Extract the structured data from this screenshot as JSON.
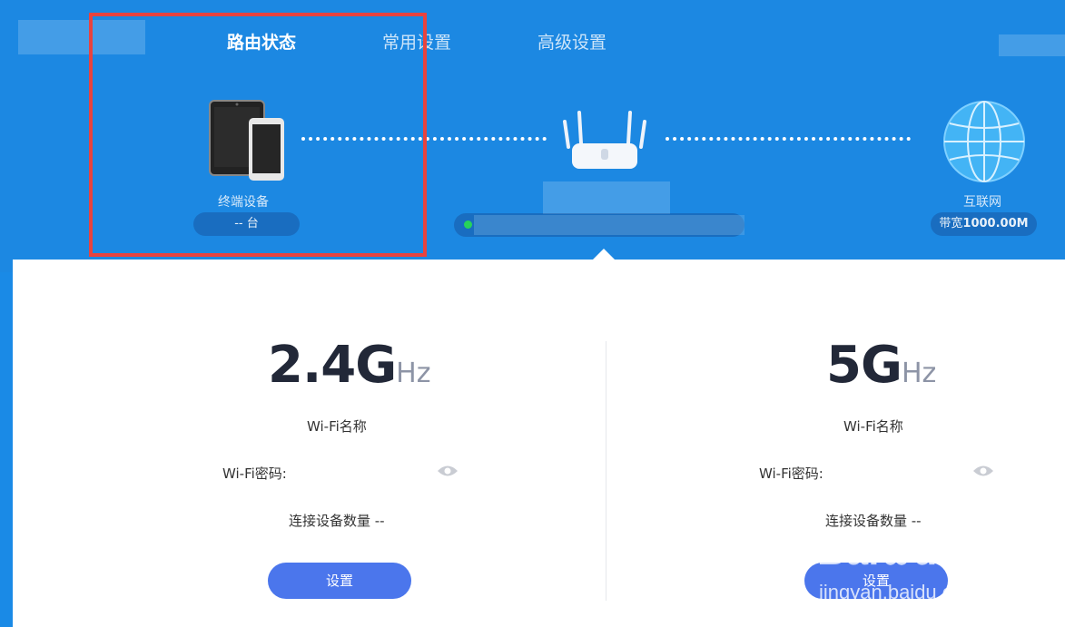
{
  "nav": {
    "tabs": [
      {
        "label": "路由状态",
        "active": true
      },
      {
        "label": "常用设置",
        "active": false
      },
      {
        "label": "高级设置",
        "active": false
      }
    ]
  },
  "topology": {
    "devices": {
      "label": "终端设备",
      "count": "-- 台",
      "icon": "tablet-phone-icon"
    },
    "router": {
      "icon": "router-icon",
      "status_color": "#27d35a"
    },
    "internet": {
      "label": "互联网",
      "bandwidth_prefix": "带宽",
      "bandwidth_value": "1000.00M",
      "icon": "globe-icon"
    }
  },
  "wifi": {
    "band_24": {
      "freq": "2.4G",
      "unit": "Hz",
      "name_label": "Wi-Fi名称",
      "password_label": "Wi-Fi密码:",
      "connected_label": "连接设备数量 --",
      "button": "设置"
    },
    "band_5": {
      "freq": "5G",
      "unit": "Hz",
      "name_label": "Wi-Fi名称",
      "password_label": "Wi-Fi密码:",
      "connected_label": "连接设备数量 --",
      "button": "设置"
    }
  },
  "watermark": {
    "brand": "Bai",
    "brand2": "du",
    "suffix": "经验",
    "url": "jingyan.baidu.com"
  },
  "colors": {
    "header_bg": "#1c88e2",
    "button": "#4b76ec",
    "highlight_box": "#e8433f"
  }
}
